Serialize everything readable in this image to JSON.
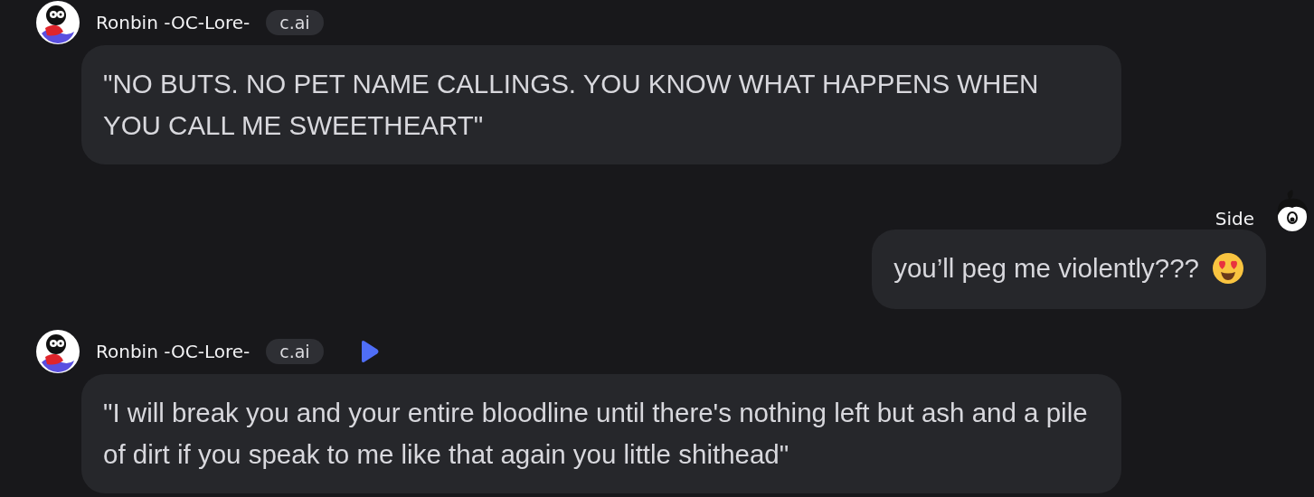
{
  "messages": [
    {
      "kind": "bot",
      "name": "Ronbin -OC-Lore-",
      "badge": "c.ai",
      "play_button": false,
      "text": "\"NO BUTS. NO PET NAME CALLINGS. YOU KNOW WHAT HAPPENS WHEN YOU CALL ME SWEETHEART\""
    },
    {
      "kind": "user",
      "name": "Side",
      "text": "you’ll peg me violently???",
      "emoji": true
    },
    {
      "kind": "bot",
      "name": "Ronbin -OC-Lore-",
      "badge": "c.ai",
      "play_button": true,
      "text": "\"I will break you and your entire bloodline until there's nothing left but ash and a pile of dirt if you speak to me like that again you little shithead\""
    }
  ]
}
